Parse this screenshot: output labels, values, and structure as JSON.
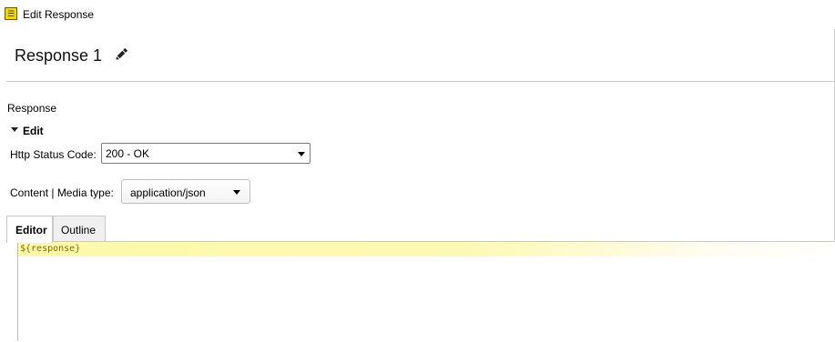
{
  "window": {
    "title": "Edit Response",
    "icon": "app-logo-icon"
  },
  "header": {
    "title": "Response 1",
    "edit_icon": "pencil-icon"
  },
  "section": {
    "label": "Response",
    "edit_label": "Edit"
  },
  "form": {
    "status_label": "Http Status Code:",
    "status_value": "200 - OK",
    "media_label": "Content | Media type:",
    "media_value": "application/json"
  },
  "tabs": [
    {
      "label": "Editor",
      "active": true
    },
    {
      "label": "Outline",
      "active": false
    }
  ],
  "editor": {
    "lines": [
      "${response}"
    ],
    "highlight_color": "#fdf9a8"
  }
}
